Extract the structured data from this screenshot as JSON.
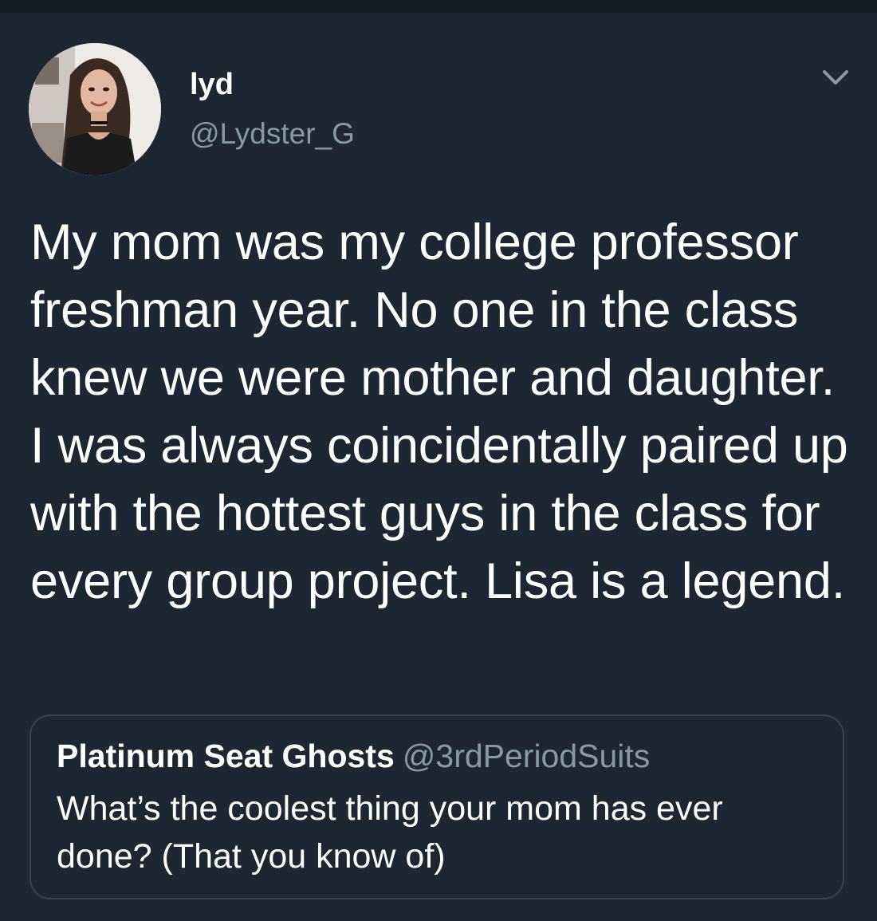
{
  "author": {
    "display_name": "lyd",
    "handle": "@Lydster_G",
    "avatar_icon": "profile-photo"
  },
  "tweet": {
    "text": "My mom was my college professor freshman year. No one in the class knew we were mother and daughter. I was always coincidentally paired up with the hottest guys in the class for every group project. Lisa is a legend."
  },
  "quoted_tweet": {
    "display_name": "Platinum Seat Ghosts",
    "handle": "@3rdPeriodSuits",
    "text": "What’s the coolest thing your mom has ever done? (That you know of)"
  },
  "icons": {
    "menu": "chevron-down-icon"
  },
  "colors": {
    "background": "#1c2733",
    "secondary_text": "#8899a6",
    "card_border": "#38444d"
  }
}
